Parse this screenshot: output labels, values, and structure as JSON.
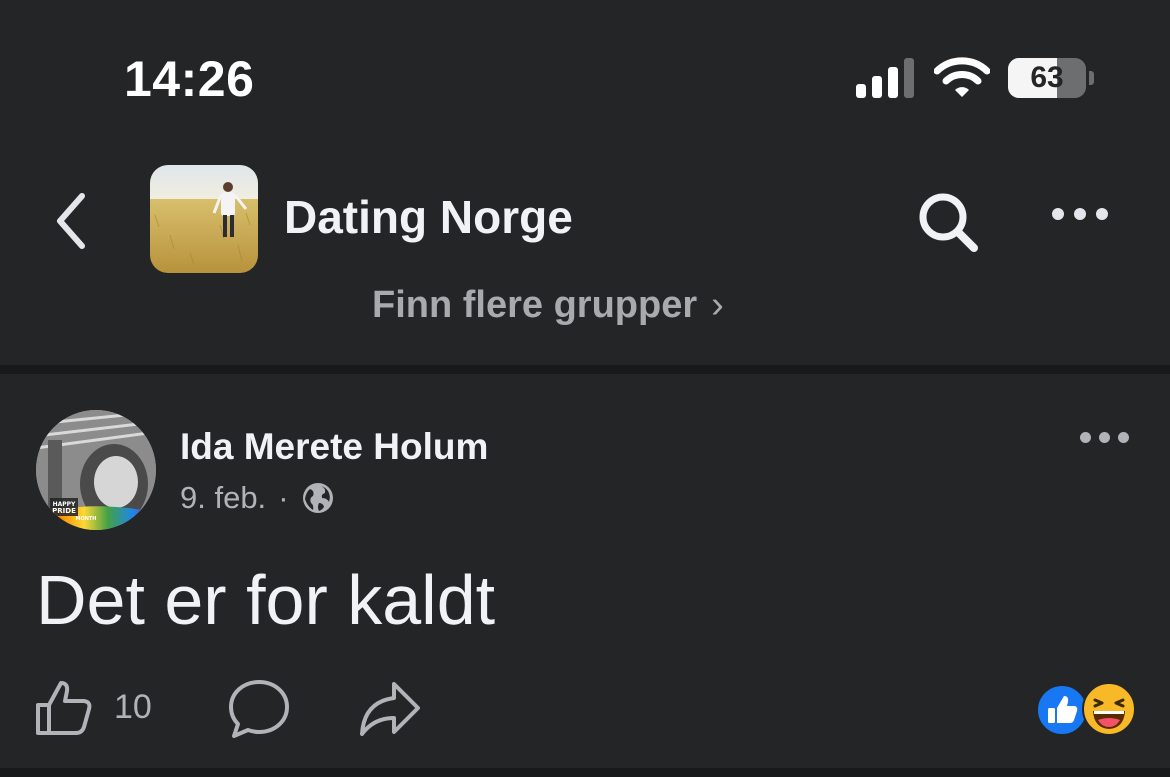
{
  "status_bar": {
    "time": "14:26",
    "battery_level": "63",
    "battery_fraction": 0.63,
    "icons": [
      "signal-icon",
      "wifi-icon",
      "battery-icon"
    ]
  },
  "header": {
    "back_icon": "chevron-left-icon",
    "group_name": "Dating Norge",
    "search_icon": "search-icon",
    "more_icon": "more-dots-icon",
    "find_more_label": "Finn flere grupper",
    "find_more_icon": "chevron-right-icon"
  },
  "post": {
    "author": "Ida Merete Holum",
    "date": "9. feb.",
    "separator": "·",
    "privacy_icon": "globe-icon",
    "text": "Det er for kaldt",
    "avatar_frame_text": "HAPPY PRIDE MONTH",
    "actions": {
      "like_icon": "thumbs-up-icon",
      "like_count": "10",
      "comment_icon": "comment-icon",
      "share_icon": "share-icon"
    },
    "reactions": [
      "like-reaction-icon",
      "haha-reaction-icon"
    ]
  },
  "colors": {
    "background": "#242526",
    "divider": "#18191a",
    "primary_text": "#f0f2f5",
    "secondary_text": "#b0b3b8",
    "like_blue": "#1877f2",
    "haha_yellow": "#f7b928"
  }
}
